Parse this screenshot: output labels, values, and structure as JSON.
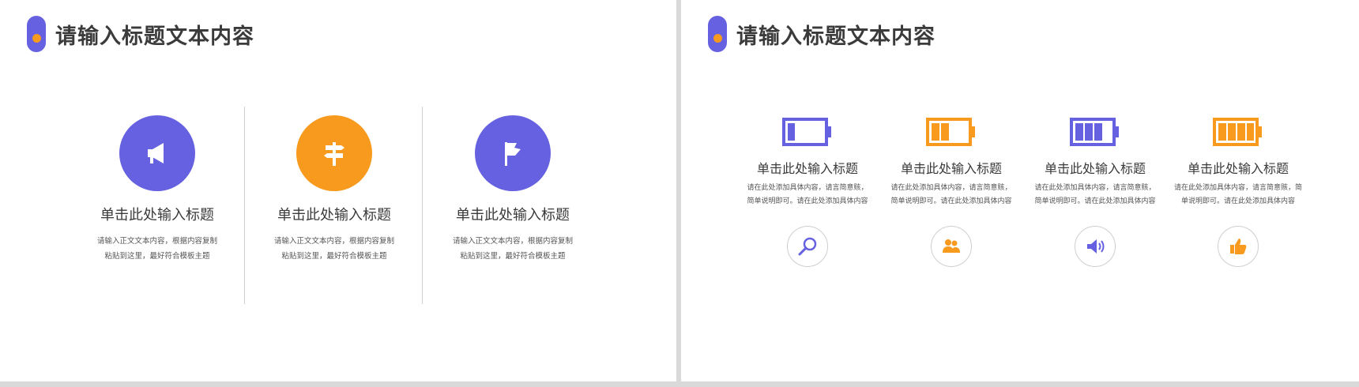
{
  "left_slide": {
    "title": "请输入标题文本内容",
    "items": [
      {
        "icon": "megaphone-icon",
        "color": "#6561e0",
        "heading": "单击此处输入标题",
        "body_line1": "请输入正文文本内容，根据内容复制",
        "body_line2": "粘贴到这里，最好符合模板主题"
      },
      {
        "icon": "signpost-icon",
        "color": "#f79a1e",
        "heading": "单击此处输入标题",
        "body_line1": "请输入正文文本内容，根据内容复制",
        "body_line2": "粘贴到这里，最好符合模板主题"
      },
      {
        "icon": "flag-icon",
        "color": "#6561e0",
        "heading": "单击此处输入标题",
        "body_line1": "请输入正文文本内容，根据内容复制",
        "body_line2": "粘贴到这里，最好符合模板主题"
      }
    ]
  },
  "right_slide": {
    "title": "请输入标题文本内容",
    "items": [
      {
        "battery_icon": "battery-icon",
        "battery_color": "#6561e0",
        "battery_level": 0.25,
        "heading": "单击此处输入标题",
        "body_line1": "请在此处添加具体内容，请言简意赅，",
        "body_line2": "简单说明即可。请在此处添加具体内容",
        "icon": "search-icon",
        "icon_color": "#6561e0"
      },
      {
        "battery_icon": "battery-icon",
        "battery_color": "#f79a1e",
        "battery_level": 0.5,
        "heading": "单击此处输入标题",
        "body_line1": "请在此处添加具体内容，请言简意赅，",
        "body_line2": "简单说明即可。请在此处添加具体内容",
        "icon": "users-icon",
        "icon_color": "#f79a1e"
      },
      {
        "battery_icon": "battery-icon",
        "battery_color": "#6561e0",
        "battery_level": 0.75,
        "heading": "单击此处输入标题",
        "body_line1": "请在此处添加具体内容，请言简意赅，",
        "body_line2": "简单说明即可。请在此处添加具体内容",
        "icon": "speaker-icon",
        "icon_color": "#6561e0"
      },
      {
        "battery_icon": "battery-icon",
        "battery_color": "#f79a1e",
        "battery_level": 1.0,
        "heading": "单击此处输入标题",
        "body_line1": "请在此处添加具体内容，请言简意赅，简",
        "body_line2": "单说明即可。请在此处添加具体内容",
        "icon": "thumbs-up-icon",
        "icon_color": "#f79a1e"
      }
    ]
  },
  "colors": {
    "accent_purple": "#6561e0",
    "accent_orange": "#f79a1e"
  }
}
